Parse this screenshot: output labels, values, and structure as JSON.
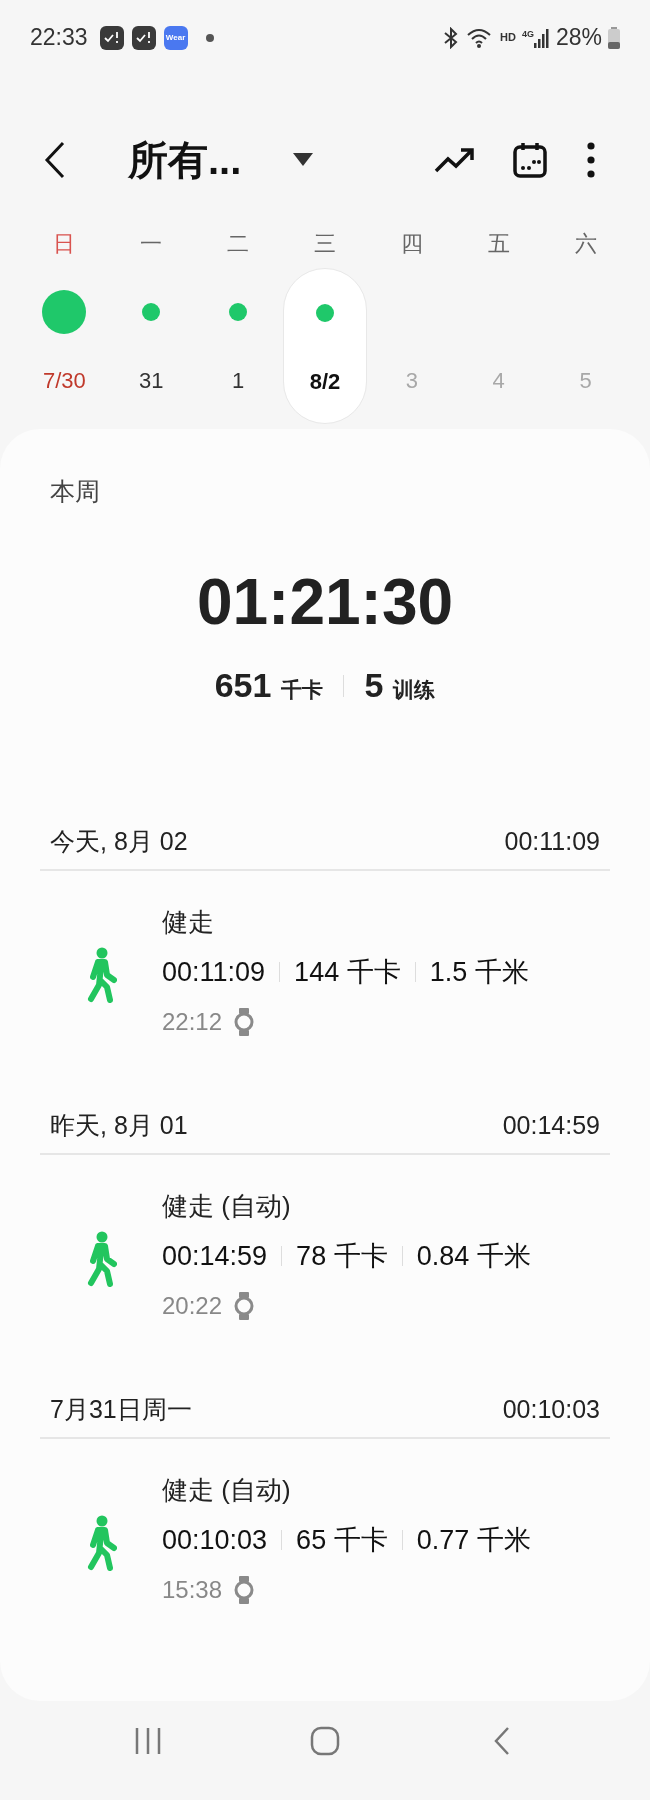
{
  "status_bar": {
    "time": "22:33",
    "wear_badge": "Wear",
    "battery": "28%",
    "network": "4G",
    "hd": "HD"
  },
  "header": {
    "title": "所有..."
  },
  "week": [
    {
      "weekday": "日",
      "date": "7/30",
      "sunday": true,
      "active": true,
      "goal_met": true,
      "future": false,
      "selected": false
    },
    {
      "weekday": "一",
      "date": "31",
      "sunday": false,
      "active": true,
      "goal_met": false,
      "future": false,
      "selected": false
    },
    {
      "weekday": "二",
      "date": "1",
      "sunday": false,
      "active": true,
      "goal_met": false,
      "future": false,
      "selected": false
    },
    {
      "weekday": "三",
      "date": "8/2",
      "sunday": false,
      "active": true,
      "goal_met": false,
      "future": false,
      "selected": true
    },
    {
      "weekday": "四",
      "date": "3",
      "sunday": false,
      "active": false,
      "future": true,
      "selected": false
    },
    {
      "weekday": "五",
      "date": "4",
      "sunday": false,
      "active": false,
      "future": true,
      "selected": false
    },
    {
      "weekday": "六",
      "date": "5",
      "sunday": false,
      "active": false,
      "future": true,
      "selected": false
    }
  ],
  "summary": {
    "label": "本周",
    "total_time": "01:21:30",
    "calories": "651",
    "calories_unit": "千卡",
    "workouts": "5",
    "workouts_unit": "训练"
  },
  "days": [
    {
      "date": "今天, 8月 02",
      "total": "00:11:09",
      "workouts": [
        {
          "name": "健走",
          "duration": "00:11:09",
          "calories": "144 千卡",
          "distance": "1.5 千米",
          "start": "22:12"
        }
      ]
    },
    {
      "date": "昨天, 8月 01",
      "total": "00:14:59",
      "workouts": [
        {
          "name": "健走 (自动)",
          "duration": "00:14:59",
          "calories": "78 千卡",
          "distance": "0.84 千米",
          "start": "20:22"
        }
      ]
    },
    {
      "date": "7月31日周一",
      "total": "00:10:03",
      "workouts": [
        {
          "name": "健走 (自动)",
          "duration": "00:10:03",
          "calories": "65 千卡",
          "distance": "0.77 千米",
          "start": "15:38"
        }
      ]
    }
  ]
}
